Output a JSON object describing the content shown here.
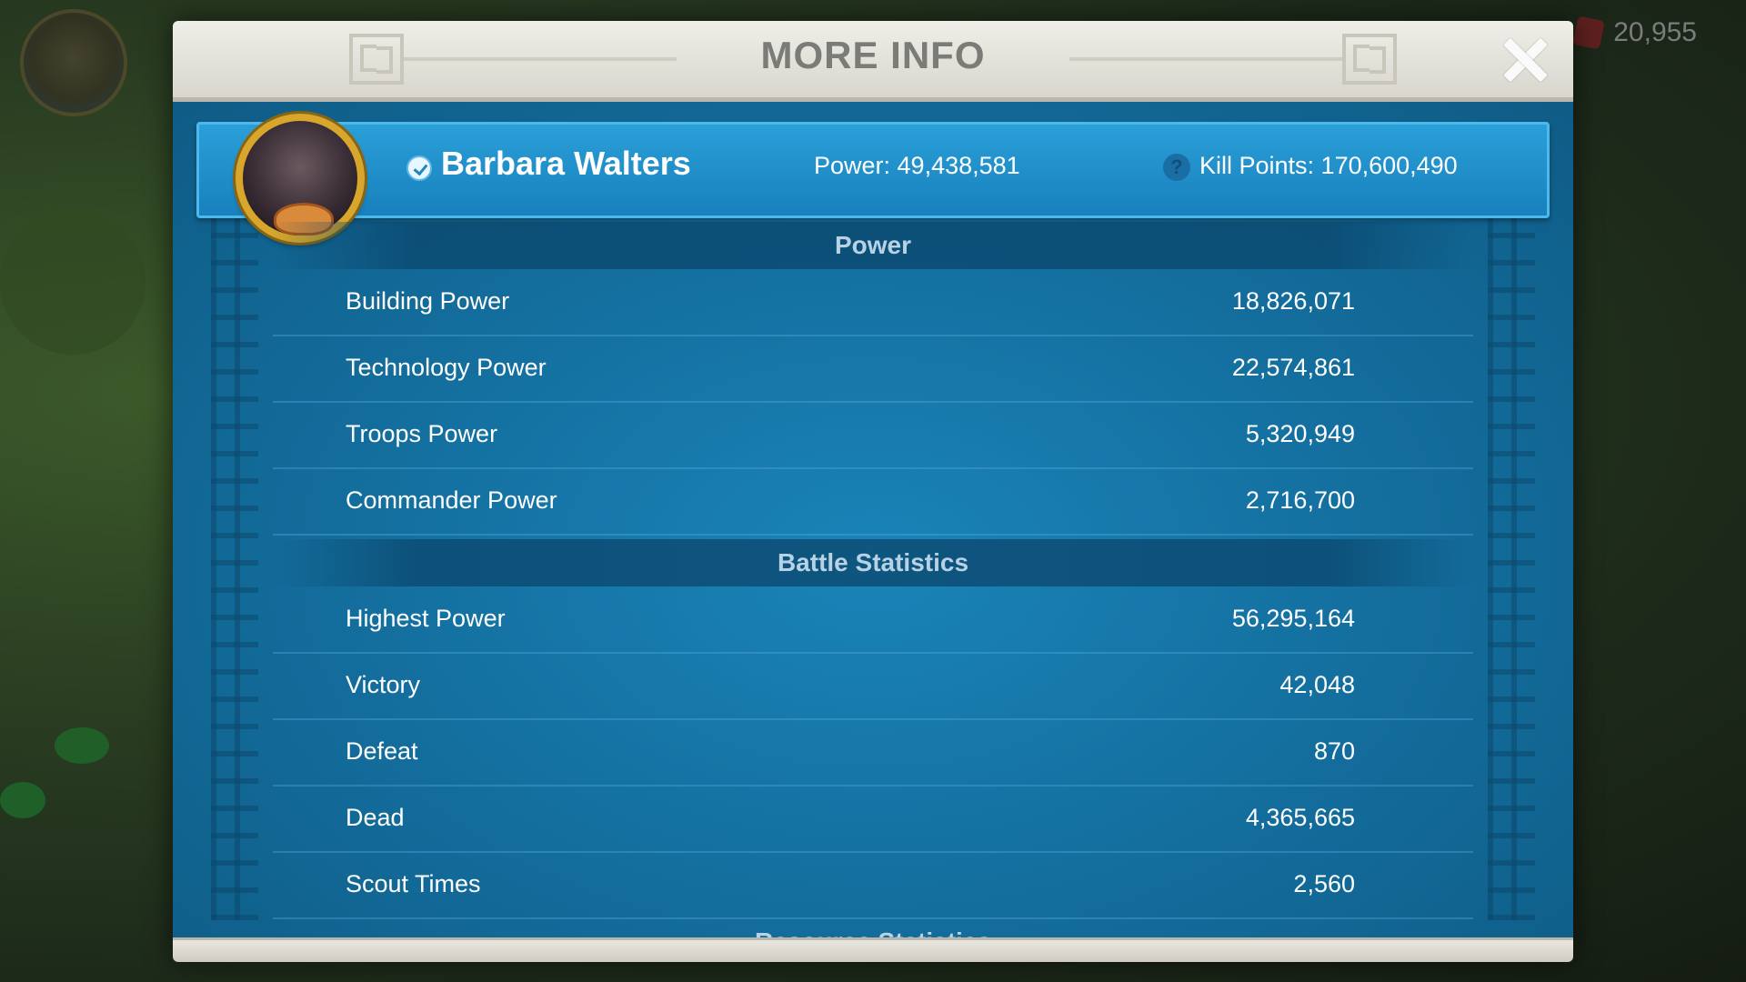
{
  "background": {
    "resource_count": "20,955"
  },
  "modal": {
    "title": "MORE INFO"
  },
  "player": {
    "name": "Barbara Walters",
    "power": "Power: 49,438,581",
    "kill_points": "Kill Points: 170,600,490"
  },
  "sections": [
    {
      "title": "Power",
      "rows": [
        {
          "label": "Building Power",
          "value": "18,826,071"
        },
        {
          "label": "Technology Power",
          "value": "22,574,861"
        },
        {
          "label": "Troops Power",
          "value": "5,320,949"
        },
        {
          "label": "Commander Power",
          "value": "2,716,700"
        }
      ]
    },
    {
      "title": "Battle Statistics",
      "rows": [
        {
          "label": "Highest Power",
          "value": "56,295,164"
        },
        {
          "label": "Victory",
          "value": "42,048"
        },
        {
          "label": "Defeat",
          "value": "870"
        },
        {
          "label": "Dead",
          "value": "4,365,665"
        },
        {
          "label": "Scout Times",
          "value": "2,560"
        }
      ]
    },
    {
      "title": "Resource Statistics"
    }
  ]
}
